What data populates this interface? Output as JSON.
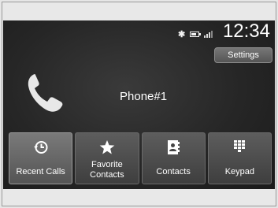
{
  "status_bar": {
    "time": "12:34",
    "icons": [
      "bluetooth-icon",
      "battery-icon",
      "signal-icon"
    ]
  },
  "header": {
    "settings_label": "Settings"
  },
  "main": {
    "device_name": "Phone#1",
    "icon": "phone-handset-icon"
  },
  "menu": {
    "items": [
      {
        "label": "Recent Calls",
        "icon": "clock-history-icon",
        "selected": true
      },
      {
        "label": "Favorite\nContacts",
        "icon": "star-icon",
        "selected": false
      },
      {
        "label": "Contacts",
        "icon": "contact-book-icon",
        "selected": false
      },
      {
        "label": "Keypad",
        "icon": "keypad-icon",
        "selected": false
      }
    ]
  }
}
